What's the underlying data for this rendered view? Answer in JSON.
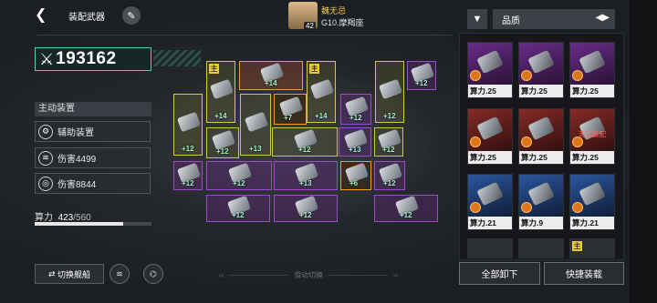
{
  "header": {
    "title": "装配武器",
    "pilot_level": "42",
    "pilot_name": "魏无忌",
    "ship_name": "G10.摩羯座"
  },
  "power": {
    "value": "193162"
  },
  "active_equipment": {
    "header": "主动装置",
    "items": [
      {
        "label": "辅助装置",
        "icon": "gear-icon"
      },
      {
        "label": "伤害4499",
        "icon": "wings-icon"
      },
      {
        "label": "伤害8844",
        "icon": "gear-target-icon"
      }
    ]
  },
  "compute": {
    "label": "算力",
    "current": "423",
    "separator": "/",
    "max": "560",
    "fill": 0.755
  },
  "bottom": {
    "switch_ship": "切换舰船",
    "swipe_hint": "滑动切换"
  },
  "grid": {
    "main_tag": "主",
    "slots": [
      {
        "level": "+14",
        "tier": "y"
      },
      {
        "level": "+14",
        "tier": "o"
      },
      {
        "level": "+14",
        "tier": "y"
      },
      {
        "level": "+12",
        "tier": "y"
      },
      {
        "level": "+12",
        "tier": "p"
      },
      {
        "level": "+12",
        "tier": "y"
      },
      {
        "level": "+7",
        "tier": "sel"
      },
      {
        "level": "+12",
        "tier": "p"
      },
      {
        "level": "+12",
        "tier": "g"
      },
      {
        "level": "+13",
        "tier": "g"
      },
      {
        "level": "+12",
        "tier": "g"
      },
      {
        "level": "+12",
        "tier": "g"
      },
      {
        "level": "+12",
        "tier": "p"
      },
      {
        "level": "+12",
        "tier": "p"
      },
      {
        "level": "+13",
        "tier": "p"
      },
      {
        "level": "+13",
        "tier": "p"
      },
      {
        "level": "+6",
        "tier": "sel"
      },
      {
        "level": "+12",
        "tier": "p"
      },
      {
        "level": "+12",
        "tier": "p"
      },
      {
        "level": "+12",
        "tier": "p"
      },
      {
        "level": "+12",
        "tier": "p"
      }
    ]
  },
  "inventory": {
    "filter_icon": "filter-icon",
    "quality_label": "品质",
    "cards": [
      {
        "cost": "算力.25",
        "color": "purple",
        "badge": true,
        "note": ""
      },
      {
        "cost": "算力.25",
        "color": "purple",
        "badge": true,
        "note": ""
      },
      {
        "cost": "算力.25",
        "color": "purple",
        "badge": true,
        "note": ""
      },
      {
        "cost": "算力.25",
        "color": "red",
        "badge": true,
        "note": ""
      },
      {
        "cost": "算力.25",
        "color": "red",
        "badge": true,
        "note": ""
      },
      {
        "cost": "算力.25",
        "color": "red",
        "badge": true,
        "note": "无法装配"
      },
      {
        "cost": "算力.21",
        "color": "blue",
        "badge": true,
        "note": ""
      },
      {
        "cost": "算力.9",
        "color": "blue",
        "badge": true,
        "note": ""
      },
      {
        "cost": "算力.21",
        "color": "blue",
        "badge": true,
        "note": ""
      }
    ],
    "unload_all": "全部卸下",
    "quick_equip": "快捷装载"
  }
}
